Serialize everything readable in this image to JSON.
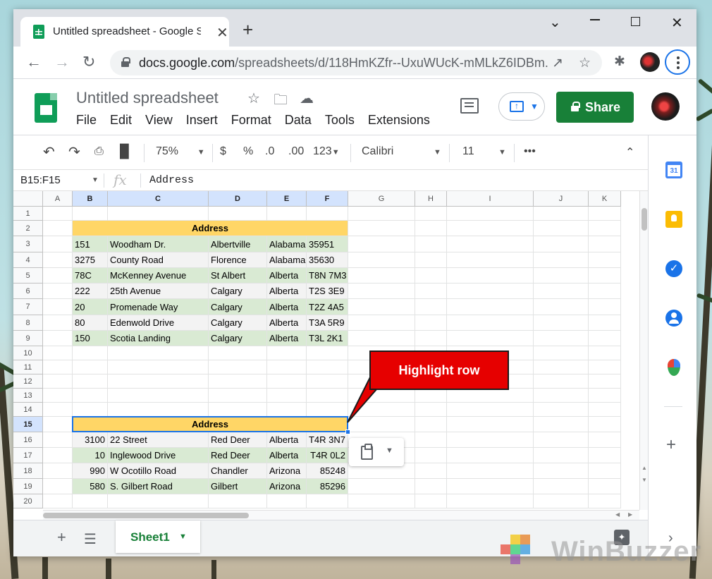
{
  "browser": {
    "tab_title": "Untitled spreadsheet - Google Sheets",
    "tab_close": "✕",
    "new_tab": "+",
    "window_controls": {
      "minimize": "⌄",
      "maximize": "☐",
      "close": "✕"
    },
    "url_host": "docs.google.com",
    "url_path": "/spreadsheets/d/118HmKZfr--UxuWUcK-mMLkZ6IDBm..."
  },
  "sheets": {
    "doc_title": "Untitled spreadsheet",
    "menu": [
      "File",
      "Edit",
      "View",
      "Insert",
      "Format",
      "Data",
      "Tools",
      "Extensions"
    ],
    "share_label": "Share",
    "toolbar": {
      "zoom": "75%",
      "currency": "$",
      "percent": "%",
      "dec_decrease": ".0",
      "dec_increase": ".00",
      "more_formats": "123",
      "font": "Calibri",
      "font_size": "11",
      "more": "•••"
    },
    "name_box": "B15:F15",
    "fx_label": "fx",
    "formula": "Address"
  },
  "grid": {
    "columns": [
      "A",
      "B",
      "C",
      "D",
      "E",
      "F",
      "G",
      "H",
      "I",
      "J",
      "K"
    ],
    "rows": [
      "1",
      "2",
      "3",
      "4",
      "5",
      "6",
      "7",
      "8",
      "9",
      "10",
      "11",
      "12",
      "13",
      "14",
      "15",
      "16",
      "17",
      "18",
      "19",
      "20"
    ],
    "table1_header": "Address",
    "table1_rows": [
      [
        "151",
        "Woodham Dr.",
        "Albertville",
        "Alabama",
        "35951"
      ],
      [
        "3275",
        "County Road",
        "Florence",
        "Alabama",
        "35630"
      ],
      [
        "78C",
        "McKenney Avenue",
        "St Albert",
        "Alberta",
        "T8N 7M3"
      ],
      [
        "222",
        "25th Avenue",
        "Calgary",
        "Alberta",
        "T2S 3E9"
      ],
      [
        "20",
        "Promenade Way",
        "Calgary",
        "Alberta",
        "T2Z 4A5"
      ],
      [
        "80",
        "Edenwold Drive",
        "Calgary",
        "Alberta",
        "T3A 5R9"
      ],
      [
        "150",
        "Scotia Landing",
        "Calgary",
        "Alberta",
        "T3L 2K1"
      ]
    ],
    "table2_header": "Address",
    "table2_rows": [
      [
        "3100",
        "22 Street",
        "Red Deer",
        "Alberta",
        "T4R 3N7"
      ],
      [
        "10",
        "Inglewood Drive",
        "Red Deer",
        "Alberta",
        "T4R 0L2"
      ],
      [
        "990",
        "W Ocotillo Road",
        "Chandler",
        "Arizona",
        "85248"
      ],
      [
        "580",
        "S. Gilbert Road",
        "Gilbert",
        "Arizona",
        "85296"
      ]
    ]
  },
  "callout": {
    "text": "Highlight row",
    "color": "#e60000"
  },
  "sheet_tabs": {
    "active": "Sheet1"
  },
  "side_panel": {
    "calendar_day": "31"
  },
  "watermark": {
    "text": "WinBuzzer"
  },
  "colors": {
    "header_fill": "#ffd666",
    "green_row": "#d9ead3",
    "gray_row": "#f3f3f3",
    "selection": "#1a73e8",
    "share_button": "#188038"
  }
}
